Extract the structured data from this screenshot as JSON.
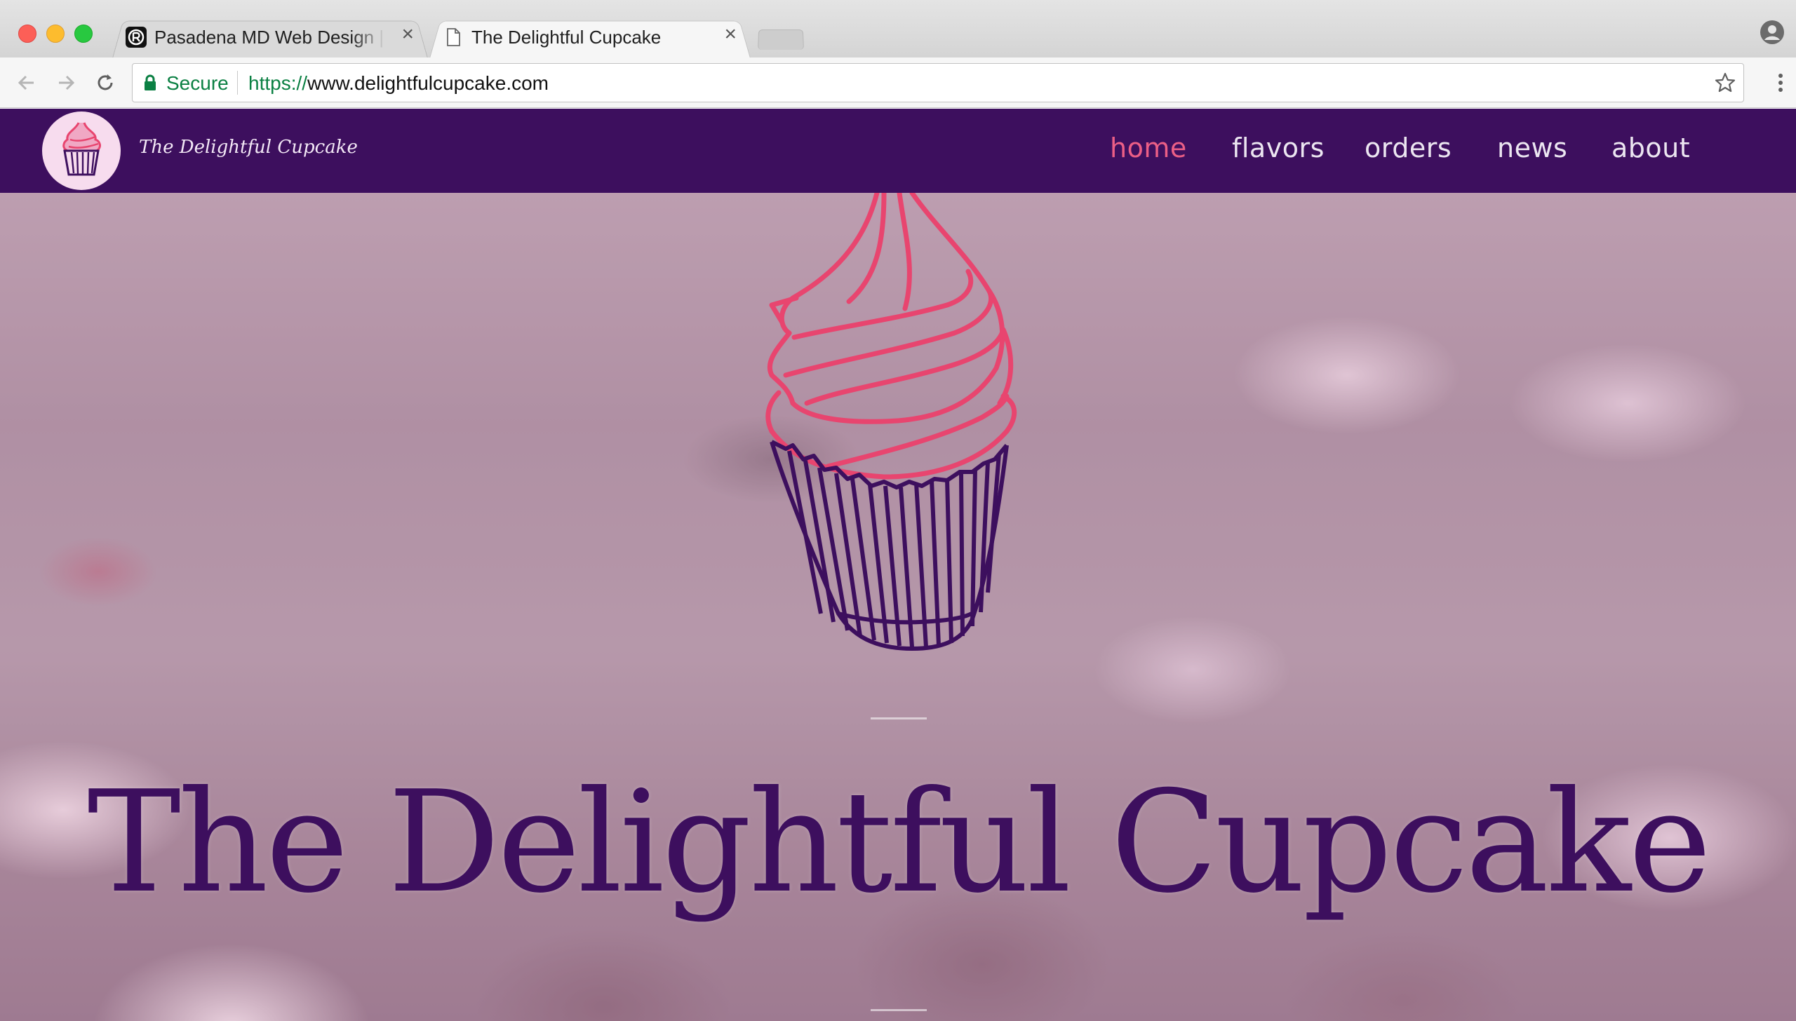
{
  "browser": {
    "tabs": [
      {
        "title": "Pasadena MD Web Design | A",
        "favicon": "pasadena-logo-icon",
        "active": false
      },
      {
        "title": "The Delightful Cupcake",
        "favicon": "page-icon",
        "active": true
      }
    ],
    "close_glyph": "×",
    "omnibox": {
      "secure_label": "Secure",
      "url_scheme": "https://",
      "url_host": "www.delightfulcupcake.com"
    }
  },
  "site": {
    "name": "The Delightful Cupcake",
    "nav": [
      {
        "label": "home",
        "active": true
      },
      {
        "label": "flavors",
        "active": false
      },
      {
        "label": "orders",
        "active": false
      },
      {
        "label": "news",
        "active": false
      },
      {
        "label": "about",
        "active": false
      }
    ],
    "hero_title": "The Delightful Cupcake"
  },
  "colors": {
    "header_bg": "#3d0f5e",
    "nav_active": "#ec5f86",
    "frosting": "#e8456f",
    "wrapper": "#3d0f5e",
    "secure_green": "#0b8043"
  }
}
